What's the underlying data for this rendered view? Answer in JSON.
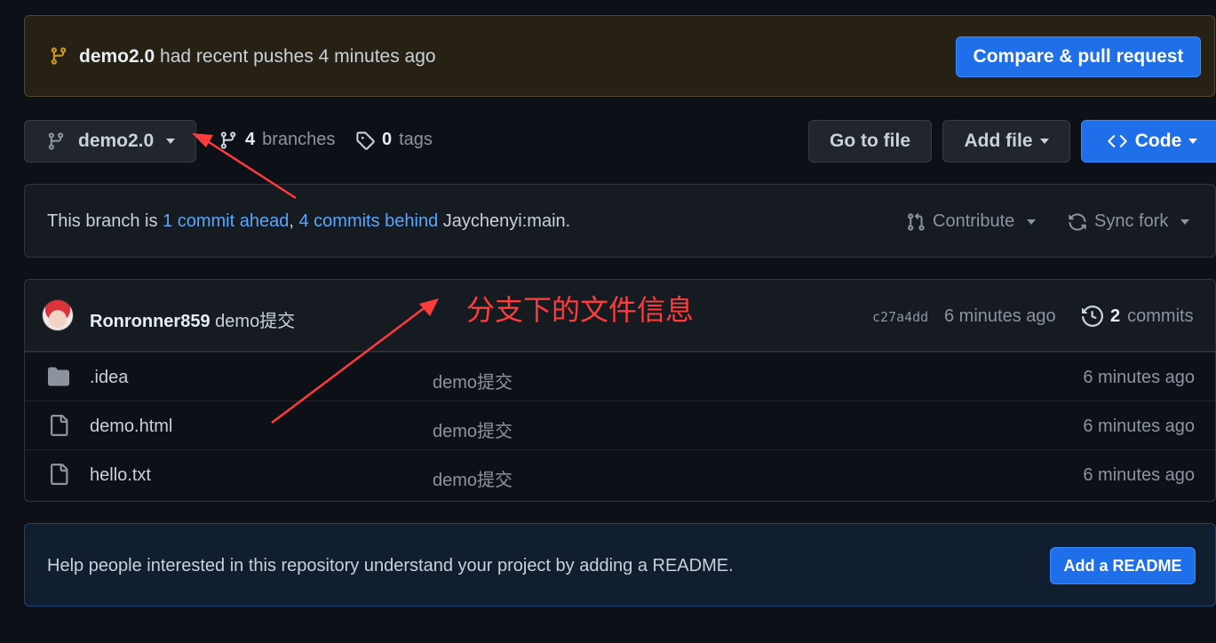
{
  "push_banner": {
    "branch": "demo2.0",
    "message": "had recent pushes 4 minutes ago",
    "compare_button": "Compare & pull request"
  },
  "toolbar": {
    "branch": "demo2.0",
    "branches_count": "4",
    "branches_label": "branches",
    "tags_count": "0",
    "tags_label": "tags",
    "go_to_file": "Go to file",
    "add_file": "Add file",
    "code": "Code"
  },
  "branch_status": {
    "prefix": "This branch is",
    "ahead": "1 commit ahead",
    "separator": ",",
    "behind": "4 commits behind",
    "upstream": "Jaychenyi:main.",
    "contribute": "Contribute",
    "sync_fork": "Sync fork"
  },
  "latest_commit": {
    "author": "Ronronner859",
    "message": "demo提交",
    "sha": "c27a4dd",
    "time": "6 minutes ago",
    "commits_count": "2",
    "commits_label": "commits"
  },
  "files": [
    {
      "name": ".idea",
      "type": "folder",
      "message": "demo提交",
      "time": "6 minutes ago"
    },
    {
      "name": "demo.html",
      "type": "file",
      "message": "demo提交",
      "time": "6 minutes ago"
    },
    {
      "name": "hello.txt",
      "type": "file",
      "message": "demo提交",
      "time": "6 minutes ago"
    }
  ],
  "readme": {
    "text": "Help people interested in this repository understand your project by adding a README.",
    "button": "Add a README"
  },
  "annotation": {
    "text": "分支下的文件信息",
    "color": "#ff3b3b"
  },
  "colors": {
    "background": "#0d1117",
    "accent": "#1f6feb",
    "link": "#58a6ff",
    "banner": "#272115"
  }
}
